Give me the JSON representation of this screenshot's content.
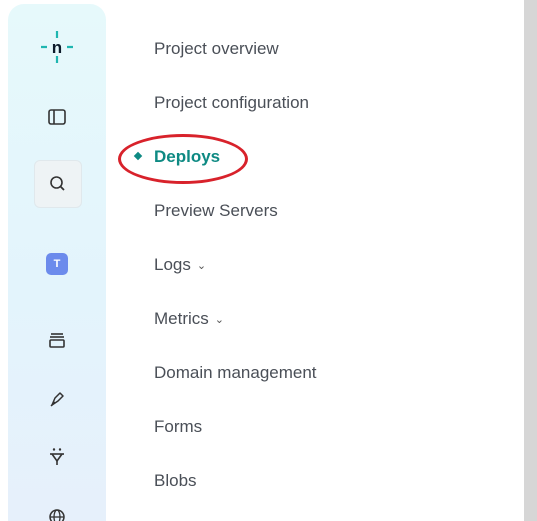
{
  "sidebar": {
    "logo_icon": "netlify-logo-icon",
    "avatar_letter": "T",
    "icons": [
      "netlify-logo-icon",
      "panel-toggle-icon",
      "search-icon",
      "team-avatar",
      "stack-icon",
      "pen-tool-icon",
      "plug-icon",
      "globe-icon"
    ]
  },
  "nav": {
    "items": [
      {
        "label": "Project overview"
      },
      {
        "label": "Project configuration"
      },
      {
        "label": "Deploys",
        "active": true
      },
      {
        "label": "Preview Servers"
      },
      {
        "label": "Logs",
        "expandable": true
      },
      {
        "label": "Metrics",
        "expandable": true
      },
      {
        "label": "Domain management"
      },
      {
        "label": "Forms"
      },
      {
        "label": "Blobs"
      }
    ]
  },
  "colors": {
    "active": "#0e8a83",
    "annotation": "#d8222b",
    "logo": "#1fb6b0"
  }
}
